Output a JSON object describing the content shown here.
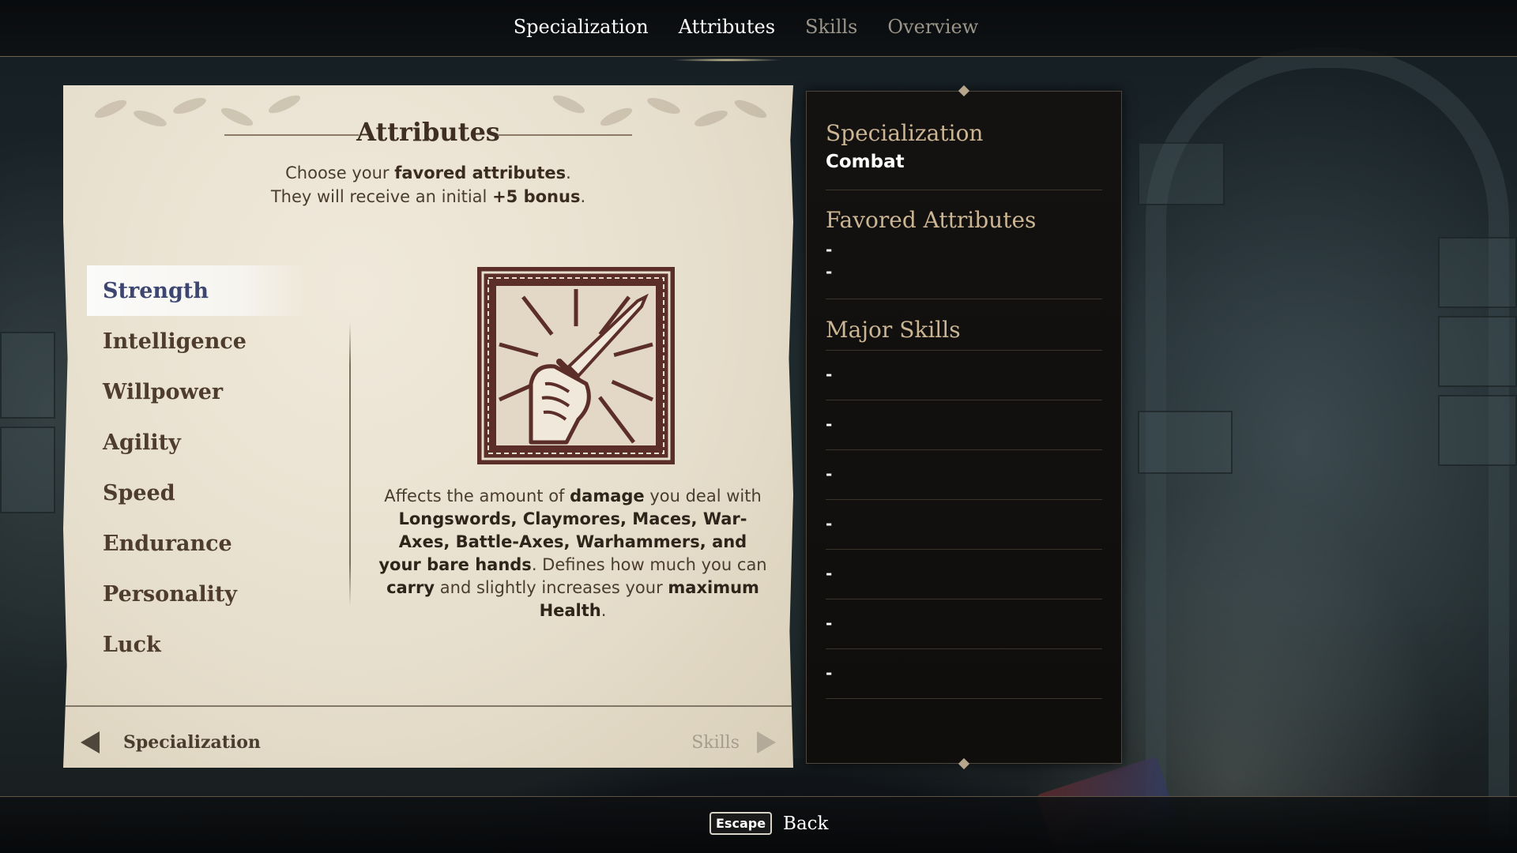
{
  "tabs": [
    {
      "label": "Specialization",
      "active": true
    },
    {
      "label": "Attributes",
      "active": true
    },
    {
      "label": "Skills",
      "active": false
    },
    {
      "label": "Overview",
      "active": false
    }
  ],
  "panel": {
    "title": "Attributes",
    "subtitle": {
      "line1_pre": "Choose your ",
      "line1_bold": "favored attributes",
      "line1_post": ".",
      "line2_pre": "They will receive an initial ",
      "line2_bold": "+5 bonus",
      "line2_post": "."
    },
    "attributes": [
      "Strength",
      "Intelligence",
      "Willpower",
      "Agility",
      "Speed",
      "Endurance",
      "Personality",
      "Luck"
    ],
    "selected_attribute": "Strength",
    "emblem_icon": "fist-sword-icon",
    "description": [
      {
        "text": "Affects the amount of ",
        "bold": false
      },
      {
        "text": "damage",
        "bold": true
      },
      {
        "text": " you deal with ",
        "bold": false
      },
      {
        "text": "Longswords, Claymores, Maces, War-Axes, Battle-Axes, Warhammers, and your bare hands",
        "bold": true
      },
      {
        "text": ". Defines how much you can ",
        "bold": false
      },
      {
        "text": "carry",
        "bold": true
      },
      {
        "text": " and slightly increases your ",
        "bold": false
      },
      {
        "text": "maximum Health",
        "bold": true
      },
      {
        "text": ".",
        "bold": false
      }
    ],
    "nav_prev": "Specialization",
    "nav_next": "Skills"
  },
  "summary": {
    "specialization_heading": "Specialization",
    "specialization_value": "Combat",
    "favored_heading": "Favored Attributes",
    "favored_values": [
      "-",
      "-"
    ],
    "major_heading": "Major Skills",
    "major_values": [
      "-",
      "-",
      "-",
      "-",
      "-",
      "-",
      "-"
    ]
  },
  "bottom": {
    "key": "Escape",
    "label": "Back"
  },
  "colors": {
    "parchment": "#e7dfcd",
    "selected_text": "#3c4670",
    "summary_heading": "#cbb592",
    "emblem": "#5b2e2a"
  }
}
